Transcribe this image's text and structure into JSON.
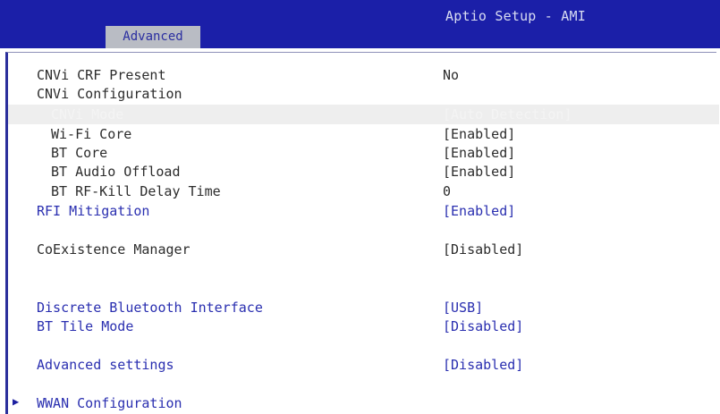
{
  "header": {
    "app_title": "Aptio Setup - AMI",
    "active_tab": "Advanced"
  },
  "colors": {
    "header_bg": "#1b1fa8",
    "tab_bg": "#b9bcc4",
    "link_text": "#2a2fb0",
    "static_text": "#2c2c2c",
    "selected_text": "#f4f4f4"
  },
  "rows": [
    {
      "label": "CNVi CRF Present",
      "value": "No"
    },
    {
      "label": "CNVi Configuration",
      "value": ""
    },
    {
      "label": "CNVi Mode",
      "value": "[Auto Detection]"
    },
    {
      "label": "Wi-Fi Core",
      "value": "[Enabled]"
    },
    {
      "label": "BT Core",
      "value": "[Enabled]"
    },
    {
      "label": "BT Audio Offload",
      "value": "[Enabled]"
    },
    {
      "label": "BT RF-Kill Delay Time",
      "value": "0"
    },
    {
      "label": "RFI Mitigation",
      "value": "[Enabled]"
    },
    {
      "label": "CoExistence Manager",
      "value": "[Disabled]"
    },
    {
      "label": "Discrete Bluetooth Interface",
      "value": "[USB]"
    },
    {
      "label": "BT Tile Mode",
      "value": "[Disabled]"
    },
    {
      "label": "Advanced settings",
      "value": "[Disabled]"
    },
    {
      "label": "WWAN Configuration",
      "value": ""
    }
  ],
  "submenu_arrow_icon": "right-triangle-icon"
}
